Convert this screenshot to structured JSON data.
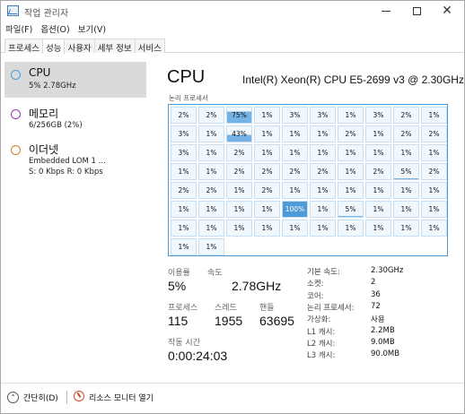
{
  "window": {
    "title": "작업 관리자",
    "controls": {
      "minimize": "—",
      "maximize": "☐",
      "close": "✕"
    }
  },
  "menu": [
    "파일(F)",
    "옵션(O)",
    "보기(V)"
  ],
  "tabs": [
    {
      "label": "프로세스",
      "active": false
    },
    {
      "label": "성능",
      "active": true
    },
    {
      "label": "사용자",
      "active": false
    },
    {
      "label": "세부 정보",
      "active": false
    },
    {
      "label": "서비스",
      "active": false
    }
  ],
  "sidebar": {
    "items": [
      {
        "title": "CPU",
        "sub": "5% 2.78GHz",
        "icon": "circle-outline",
        "color": "#4f9fd6",
        "selected": true
      },
      {
        "title": "메모리",
        "sub": "6/256GB (2%)",
        "icon": "circle-outline",
        "color": "#9b34b8",
        "selected": false
      },
      {
        "title": "이더넷",
        "sub": "Embedded LOM 1 ...",
        "sub2": "S: 0 Kbps R: 0 Kbps",
        "icon": "circle-outline",
        "color": "#cf7f30",
        "selected": false
      }
    ]
  },
  "main": {
    "title": "CPU",
    "model": "Intel(R) Xeon(R) CPU E5-2699 v3 @ 2.30GHz",
    "logical_label": "논리 프로세서",
    "grid_accent": "#4c9ad8",
    "cores": [
      "2%",
      "2%",
      "75%",
      "1%",
      "3%",
      "3%",
      "1%",
      "3%",
      "2%",
      "1%",
      "3%",
      "1%",
      "43%",
      "1%",
      "1%",
      "1%",
      "2%",
      "1%",
      "2%",
      "2%",
      "3%",
      "1%",
      "2%",
      "1%",
      "1%",
      "1%",
      "1%",
      "1%",
      "1%",
      "1%",
      "1%",
      "1%",
      "2%",
      "2%",
      "2%",
      "2%",
      "1%",
      "2%",
      "5%",
      "2%",
      "2%",
      "2%",
      "1%",
      "2%",
      "1%",
      "1%",
      "1%",
      "1%",
      "1%",
      "1%",
      "1%",
      "1%",
      "1%",
      "1%",
      "100%",
      "1%",
      "5%",
      "1%",
      "1%",
      "1%",
      "1%",
      "1%",
      "1%",
      "1%",
      "1%",
      "1%",
      "1%",
      "1%",
      "1%",
      "1%",
      "1%",
      "1%"
    ],
    "core_loads": [
      0.02,
      0.02,
      0.75,
      0.01,
      0.03,
      0.03,
      0.01,
      0.03,
      0.02,
      0.01,
      0.03,
      0.01,
      0.43,
      0.01,
      0.01,
      0.01,
      0.02,
      0.01,
      0.02,
      0.02,
      0.03,
      0.01,
      0.02,
      0.01,
      0.01,
      0.01,
      0.01,
      0.01,
      0.01,
      0.01,
      0.01,
      0.01,
      0.02,
      0.02,
      0.02,
      0.02,
      0.01,
      0.02,
      0.05,
      0.02,
      0.02,
      0.02,
      0.01,
      0.02,
      0.01,
      0.01,
      0.01,
      0.01,
      0.01,
      0.01,
      0.01,
      0.01,
      0.01,
      0.01,
      1.0,
      0.01,
      0.05,
      0.01,
      0.01,
      0.01,
      0.01,
      0.01,
      0.01,
      0.01,
      0.01,
      0.01,
      0.01,
      0.01,
      0.01,
      0.01,
      0.01,
      0.01
    ],
    "stats": {
      "utilization_label": "이용률",
      "utilization": "5%",
      "speed_label": "속도",
      "speed": "2.78GHz",
      "processes_label": "프로세스",
      "processes": "115",
      "threads_label": "스레드",
      "threads": "1955",
      "handles_label": "핸들",
      "handles": "63695",
      "uptime_label": "작동 시간",
      "uptime": "0:00:24:03"
    },
    "specs": [
      {
        "label": "기본 속도:",
        "value": "2.30GHz"
      },
      {
        "label": "소켓:",
        "value": "2"
      },
      {
        "label": "코어:",
        "value": "36"
      },
      {
        "label": "논리 프로세서:",
        "value": "72"
      },
      {
        "label": "가상화:",
        "value": "사용"
      },
      {
        "label": "L1 캐시:",
        "value": "2.2MB"
      },
      {
        "label": "L2 캐시:",
        "value": "9.0MB"
      },
      {
        "label": "L3 캐시:",
        "value": "90.0MB"
      }
    ]
  },
  "footer": {
    "fewer_details": "간단히(D)",
    "resource_monitor": "리소스 모니터 열기"
  }
}
